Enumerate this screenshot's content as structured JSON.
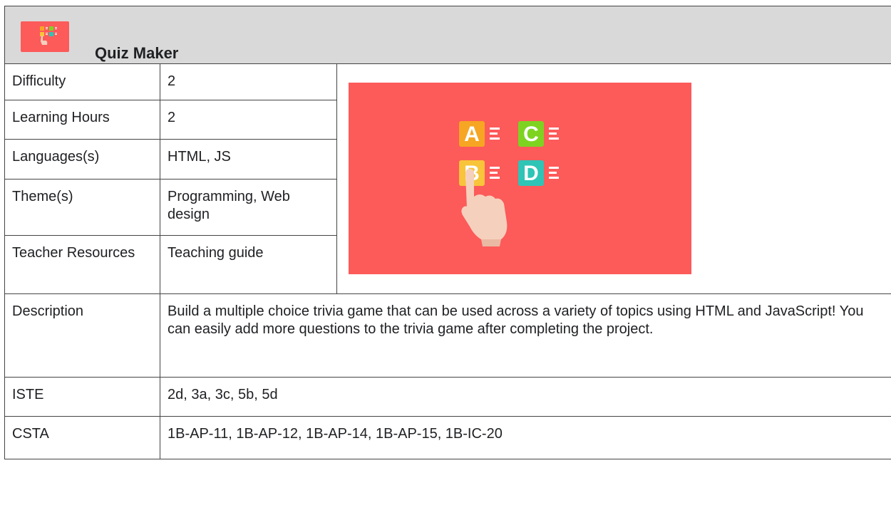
{
  "header": {
    "title": "Quiz Maker",
    "logo_icon": "quiz-abcd-icon"
  },
  "rows": [
    {
      "label": "Difficulty",
      "value": "2"
    },
    {
      "label": "Learning Hours",
      "value": "2"
    },
    {
      "label": "Languages(s)",
      "value": "HTML, JS"
    },
    {
      "label": "Theme(s)",
      "value": "Programming, Web design"
    },
    {
      "label": "Teacher Resources",
      "value": "Teaching guide"
    },
    {
      "label": "Description",
      "value": "Build a multiple choice trivia game that can be used across a variety of topics using HTML and JavaScript! You can easily add more questions to the trivia game after completing the project."
    },
    {
      "label": "ISTE",
      "value": "2d, 3a, 3c, 5b, 5d"
    },
    {
      "label": "CSTA",
      "value": "1B-AP-11, 1B-AP-12, 1B-AP-14, 1B-AP-15, 1B-IC-20"
    }
  ],
  "hero": {
    "icon": "quiz-choice-hand-icon",
    "background": "#fd5a5a",
    "tiles": [
      {
        "letter": "A",
        "color": "#f6a623"
      },
      {
        "letter": "C",
        "color": "#7ed321"
      },
      {
        "letter": "B",
        "color": "#f8c43a"
      },
      {
        "letter": "D",
        "color": "#2ec4b6"
      }
    ]
  }
}
